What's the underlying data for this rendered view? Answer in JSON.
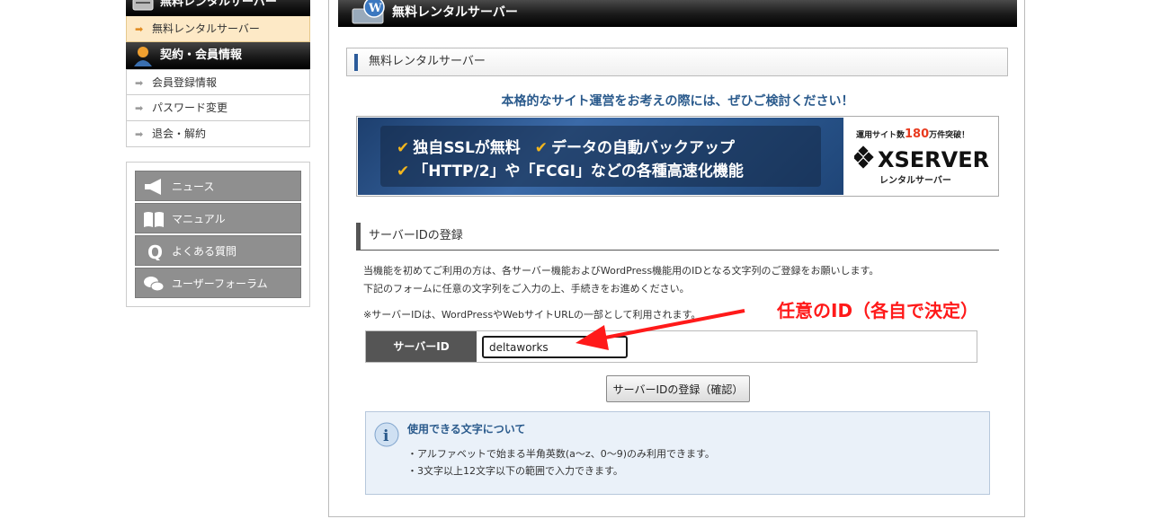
{
  "sidebar": {
    "section1_header": "無料レンタルサーバー",
    "section1_items": [
      {
        "label": "無料レンタルサーバー",
        "active": true
      }
    ],
    "section2_header": "契約・会員情報",
    "section2_items": [
      {
        "label": "会員登録情報"
      },
      {
        "label": "パスワード変更"
      },
      {
        "label": "退会・解約"
      }
    ],
    "support_buttons": [
      {
        "label": "ニュース",
        "icon": "megaphone-icon"
      },
      {
        "label": "マニュアル",
        "icon": "book-icon"
      },
      {
        "label": "よくある質問",
        "icon": "q-icon"
      },
      {
        "label": "ユーザーフォーラム",
        "icon": "chat-bubbles-icon"
      }
    ]
  },
  "main": {
    "header_title": "無料レンタルサーバー",
    "sub_title": "無料レンタルサーバー",
    "promo_text": "本格的なサイト運営をお考えの際には、ぜひご検討ください！",
    "banner": {
      "line1_a": "独自SSLが無料",
      "line1_b": "データの自動バックアップ",
      "line2": "「HTTP/2」や「FCGI」などの各種高速化機能",
      "tag_prefix": "運用サイト数",
      "tag_number": "180",
      "tag_suffix": "万件突破！",
      "logo_word": "XSERVER",
      "logo_sub": "レンタルサーバー"
    },
    "section_title": "サーバーIDの登録",
    "desc_line1": "当機能を初めてご利用の方は、各サーバー機能およびWordPress機能用のIDとなる文字列のご登録をお願いします。",
    "desc_line2": "下記のフォームに任意の文字列をご入力の上、手続きをお進めください。",
    "desc_line3": "※サーバーIDは、WordPressやWebサイトURLの一部として利用されます。",
    "form": {
      "label": "サーバーID",
      "value": "deltaworks"
    },
    "submit_label": "サーバーIDの登録（確認）",
    "info": {
      "title": "使用できる文字について",
      "line1": "・アルファベットで始まる半角英数(a～z、0～9)のみ利用できます。",
      "line2": "・3文字以上12文字以下の範囲で入力できます。"
    }
  },
  "annotation": {
    "text": "任意のID（各自で決定）",
    "color": "#ff1a1a"
  },
  "colors": {
    "accent_blue": "#2a5a8c",
    "banner_orange": "#f2b61e",
    "active_item_bg": "#fde9c6"
  }
}
